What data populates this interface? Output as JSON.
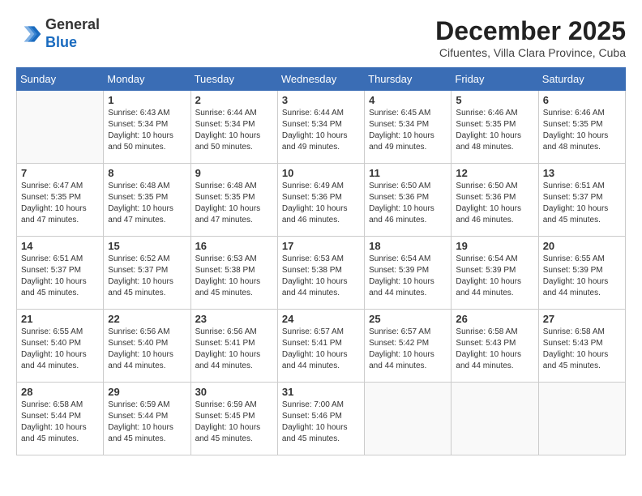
{
  "header": {
    "logo_line1": "General",
    "logo_line2": "Blue",
    "month_year": "December 2025",
    "location": "Cifuentes, Villa Clara Province, Cuba"
  },
  "days_of_week": [
    "Sunday",
    "Monday",
    "Tuesday",
    "Wednesday",
    "Thursday",
    "Friday",
    "Saturday"
  ],
  "weeks": [
    [
      {
        "day": "",
        "info": ""
      },
      {
        "day": "1",
        "info": "Sunrise: 6:43 AM\nSunset: 5:34 PM\nDaylight: 10 hours\nand 50 minutes."
      },
      {
        "day": "2",
        "info": "Sunrise: 6:44 AM\nSunset: 5:34 PM\nDaylight: 10 hours\nand 50 minutes."
      },
      {
        "day": "3",
        "info": "Sunrise: 6:44 AM\nSunset: 5:34 PM\nDaylight: 10 hours\nand 49 minutes."
      },
      {
        "day": "4",
        "info": "Sunrise: 6:45 AM\nSunset: 5:34 PM\nDaylight: 10 hours\nand 49 minutes."
      },
      {
        "day": "5",
        "info": "Sunrise: 6:46 AM\nSunset: 5:35 PM\nDaylight: 10 hours\nand 48 minutes."
      },
      {
        "day": "6",
        "info": "Sunrise: 6:46 AM\nSunset: 5:35 PM\nDaylight: 10 hours\nand 48 minutes."
      }
    ],
    [
      {
        "day": "7",
        "info": "Sunrise: 6:47 AM\nSunset: 5:35 PM\nDaylight: 10 hours\nand 47 minutes."
      },
      {
        "day": "8",
        "info": "Sunrise: 6:48 AM\nSunset: 5:35 PM\nDaylight: 10 hours\nand 47 minutes."
      },
      {
        "day": "9",
        "info": "Sunrise: 6:48 AM\nSunset: 5:35 PM\nDaylight: 10 hours\nand 47 minutes."
      },
      {
        "day": "10",
        "info": "Sunrise: 6:49 AM\nSunset: 5:36 PM\nDaylight: 10 hours\nand 46 minutes."
      },
      {
        "day": "11",
        "info": "Sunrise: 6:50 AM\nSunset: 5:36 PM\nDaylight: 10 hours\nand 46 minutes."
      },
      {
        "day": "12",
        "info": "Sunrise: 6:50 AM\nSunset: 5:36 PM\nDaylight: 10 hours\nand 46 minutes."
      },
      {
        "day": "13",
        "info": "Sunrise: 6:51 AM\nSunset: 5:37 PM\nDaylight: 10 hours\nand 45 minutes."
      }
    ],
    [
      {
        "day": "14",
        "info": "Sunrise: 6:51 AM\nSunset: 5:37 PM\nDaylight: 10 hours\nand 45 minutes."
      },
      {
        "day": "15",
        "info": "Sunrise: 6:52 AM\nSunset: 5:37 PM\nDaylight: 10 hours\nand 45 minutes."
      },
      {
        "day": "16",
        "info": "Sunrise: 6:53 AM\nSunset: 5:38 PM\nDaylight: 10 hours\nand 45 minutes."
      },
      {
        "day": "17",
        "info": "Sunrise: 6:53 AM\nSunset: 5:38 PM\nDaylight: 10 hours\nand 44 minutes."
      },
      {
        "day": "18",
        "info": "Sunrise: 6:54 AM\nSunset: 5:39 PM\nDaylight: 10 hours\nand 44 minutes."
      },
      {
        "day": "19",
        "info": "Sunrise: 6:54 AM\nSunset: 5:39 PM\nDaylight: 10 hours\nand 44 minutes."
      },
      {
        "day": "20",
        "info": "Sunrise: 6:55 AM\nSunset: 5:39 PM\nDaylight: 10 hours\nand 44 minutes."
      }
    ],
    [
      {
        "day": "21",
        "info": "Sunrise: 6:55 AM\nSunset: 5:40 PM\nDaylight: 10 hours\nand 44 minutes."
      },
      {
        "day": "22",
        "info": "Sunrise: 6:56 AM\nSunset: 5:40 PM\nDaylight: 10 hours\nand 44 minutes."
      },
      {
        "day": "23",
        "info": "Sunrise: 6:56 AM\nSunset: 5:41 PM\nDaylight: 10 hours\nand 44 minutes."
      },
      {
        "day": "24",
        "info": "Sunrise: 6:57 AM\nSunset: 5:41 PM\nDaylight: 10 hours\nand 44 minutes."
      },
      {
        "day": "25",
        "info": "Sunrise: 6:57 AM\nSunset: 5:42 PM\nDaylight: 10 hours\nand 44 minutes."
      },
      {
        "day": "26",
        "info": "Sunrise: 6:58 AM\nSunset: 5:43 PM\nDaylight: 10 hours\nand 44 minutes."
      },
      {
        "day": "27",
        "info": "Sunrise: 6:58 AM\nSunset: 5:43 PM\nDaylight: 10 hours\nand 45 minutes."
      }
    ],
    [
      {
        "day": "28",
        "info": "Sunrise: 6:58 AM\nSunset: 5:44 PM\nDaylight: 10 hours\nand 45 minutes."
      },
      {
        "day": "29",
        "info": "Sunrise: 6:59 AM\nSunset: 5:44 PM\nDaylight: 10 hours\nand 45 minutes."
      },
      {
        "day": "30",
        "info": "Sunrise: 6:59 AM\nSunset: 5:45 PM\nDaylight: 10 hours\nand 45 minutes."
      },
      {
        "day": "31",
        "info": "Sunrise: 7:00 AM\nSunset: 5:46 PM\nDaylight: 10 hours\nand 45 minutes."
      },
      {
        "day": "",
        "info": ""
      },
      {
        "day": "",
        "info": ""
      },
      {
        "day": "",
        "info": ""
      }
    ]
  ]
}
